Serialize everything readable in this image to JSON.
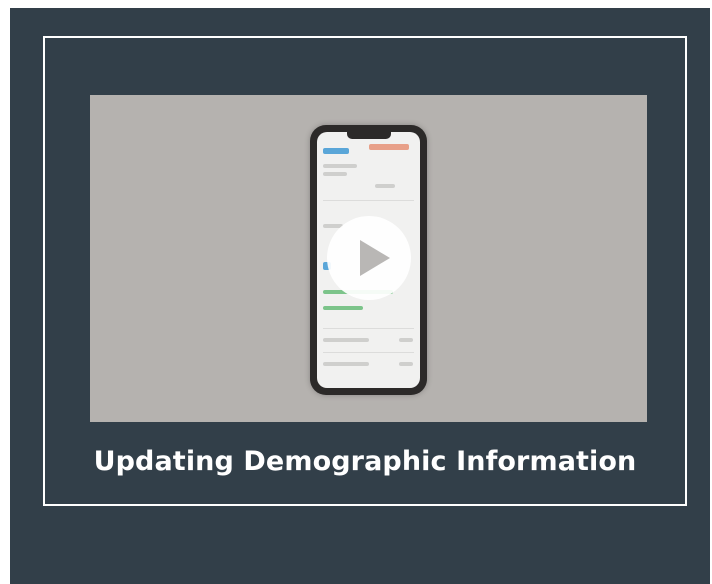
{
  "video_card": {
    "title": "Updating Demographic Information",
    "thumbnail_icon": "phone-app-screenshot",
    "play_icon": "play-icon"
  },
  "colors": {
    "panel_background": "#323f49",
    "card_border": "#ffffff",
    "thumbnail_background": "#b5b2af",
    "title_text": "#ffffff"
  }
}
